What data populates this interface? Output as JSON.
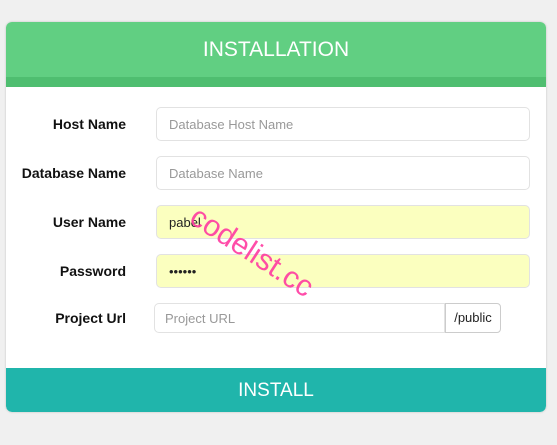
{
  "header": {
    "title": "INSTALLATION"
  },
  "fields": [
    {
      "label": "Host Name",
      "placeholder": "Database Host Name",
      "value": ""
    },
    {
      "label": "Database Name",
      "placeholder": "Database Name",
      "value": ""
    },
    {
      "label": "User Name",
      "placeholder": "",
      "value": "pabel"
    },
    {
      "label": "Password",
      "placeholder": "",
      "value": "pabel1"
    },
    {
      "label": "Project Url",
      "placeholder": "Project URL",
      "value": "",
      "addon": "/public"
    }
  ],
  "install_label": "INSTALL",
  "watermark": "codelist.cc",
  "colors": {
    "header": "#61cf82",
    "header_stripe": "#4fbe70",
    "button": "#20b5ab",
    "autofill": "#fbffbf"
  }
}
